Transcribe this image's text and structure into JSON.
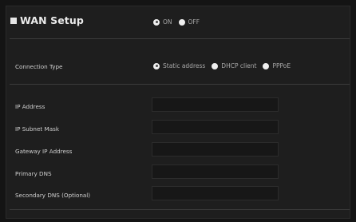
{
  "wan": {
    "title": "WAN Setup",
    "toggle": {
      "on_label": "ON",
      "off_label": "OFF",
      "selected": "ON"
    }
  },
  "connection": {
    "label": "Connection Type",
    "options": [
      {
        "label": "Static address",
        "selected": true
      },
      {
        "label": "DHCP client",
        "selected": false
      },
      {
        "label": "PPPoE",
        "selected": false
      }
    ]
  },
  "fields": [
    {
      "label": "IP Address",
      "value": ""
    },
    {
      "label": "IP Subnet Mask",
      "value": ""
    },
    {
      "label": "Gateway IP Address",
      "value": ""
    },
    {
      "label": "Primary DNS",
      "value": ""
    },
    {
      "label": "Secondary DNS (Optional)",
      "value": ""
    }
  ]
}
